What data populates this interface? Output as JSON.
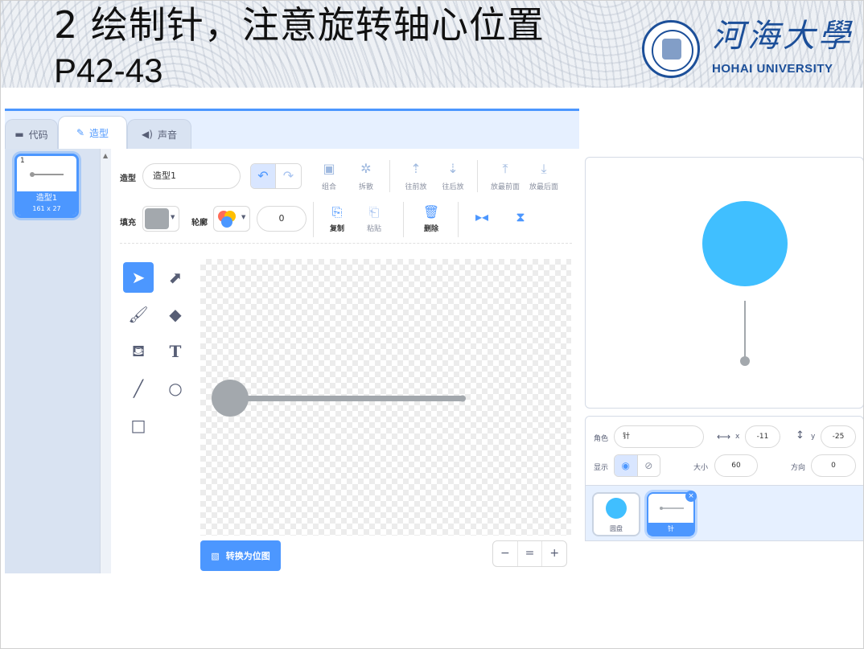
{
  "slide": {
    "title": "2 绘制针，注意旋转轴心位置",
    "subtitle": "P42-43",
    "logo_cn": "河海大學",
    "logo_en": "HOHAI UNIVERSITY"
  },
  "tabs": [
    {
      "label": "代码",
      "icon": "code-icon"
    },
    {
      "label": "造型",
      "icon": "brush-icon",
      "active": true
    },
    {
      "label": "声音",
      "icon": "speaker-icon"
    }
  ],
  "costume_list": {
    "number": "1",
    "name": "造型1",
    "size": "161 x 27"
  },
  "paint_editor": {
    "costume_label": "造型",
    "costume_name": "造型1",
    "fill_label": "填充",
    "fill_color": "#a3a8ad",
    "outline_label": "轮廓",
    "outline_width": "0",
    "group_tools": [
      {
        "label": "组合",
        "icon": "group-icon"
      },
      {
        "label": "拆散",
        "icon": "ungroup-icon"
      },
      {
        "label": "往前放",
        "icon": "forward-icon"
      },
      {
        "label": "往后放",
        "icon": "backward-icon"
      },
      {
        "label": "放最前面",
        "icon": "front-icon"
      },
      {
        "label": "放最后面",
        "icon": "back-icon"
      }
    ],
    "edit_tools": [
      {
        "label": "复制",
        "icon": "copy-icon"
      },
      {
        "label": "粘贴",
        "icon": "paste-icon"
      },
      {
        "label": "删除",
        "icon": "trash-icon"
      }
    ],
    "convert_button": "转换为位图",
    "zoom": {
      "out": "−",
      "reset": "=",
      "in": "+"
    }
  },
  "sprite_info": {
    "sprite_label": "角色",
    "sprite_name": "针",
    "x_label": "x",
    "x_value": "-11",
    "y_label": "y",
    "y_value": "-25",
    "show_label": "显示",
    "size_label": "大小",
    "size_value": "60",
    "direction_label": "方向",
    "direction_value": "0"
  },
  "sprites": [
    {
      "name": "圆盘",
      "color": "#40bfff"
    },
    {
      "name": "针",
      "selected": true
    }
  ],
  "colors": {
    "accent": "#4c97ff",
    "stage_circle": "#40bfff",
    "needle": "#a3a8ad"
  }
}
